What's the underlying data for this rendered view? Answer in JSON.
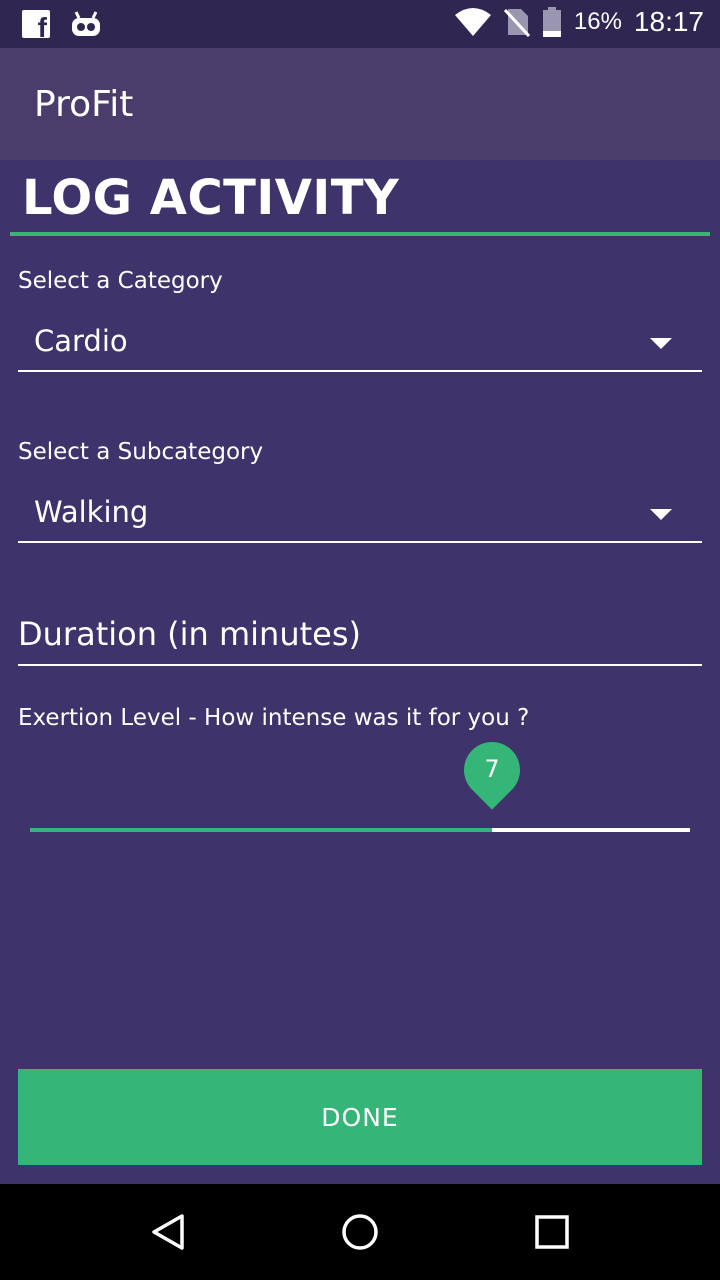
{
  "status_bar": {
    "battery": "16%",
    "time": "18:17"
  },
  "app_bar": {
    "title": "ProFit"
  },
  "page": {
    "title": "LOG ACTIVITY"
  },
  "form": {
    "category_label": "Select a Category",
    "category_value": "Cardio",
    "subcategory_label": "Select a Subcategory",
    "subcategory_value": "Walking",
    "duration_placeholder": "Duration (in minutes)",
    "exertion_label": "Exertion Level - How intense was it for you ?",
    "exertion_value": "7",
    "exertion_min": 0,
    "exertion_max": 10
  },
  "actions": {
    "done_label": "DONE"
  },
  "colors": {
    "background": "#3e336b",
    "app_bar": "#4a3d6b",
    "status_bar": "#2f2752",
    "accent": "#35b577"
  },
  "icons": {
    "status_left": [
      "facebook-icon",
      "android-icon"
    ],
    "status_right": [
      "wifi-icon",
      "no-sim-icon",
      "battery-icon"
    ],
    "nav": [
      "back-icon",
      "home-icon",
      "recents-icon"
    ]
  }
}
